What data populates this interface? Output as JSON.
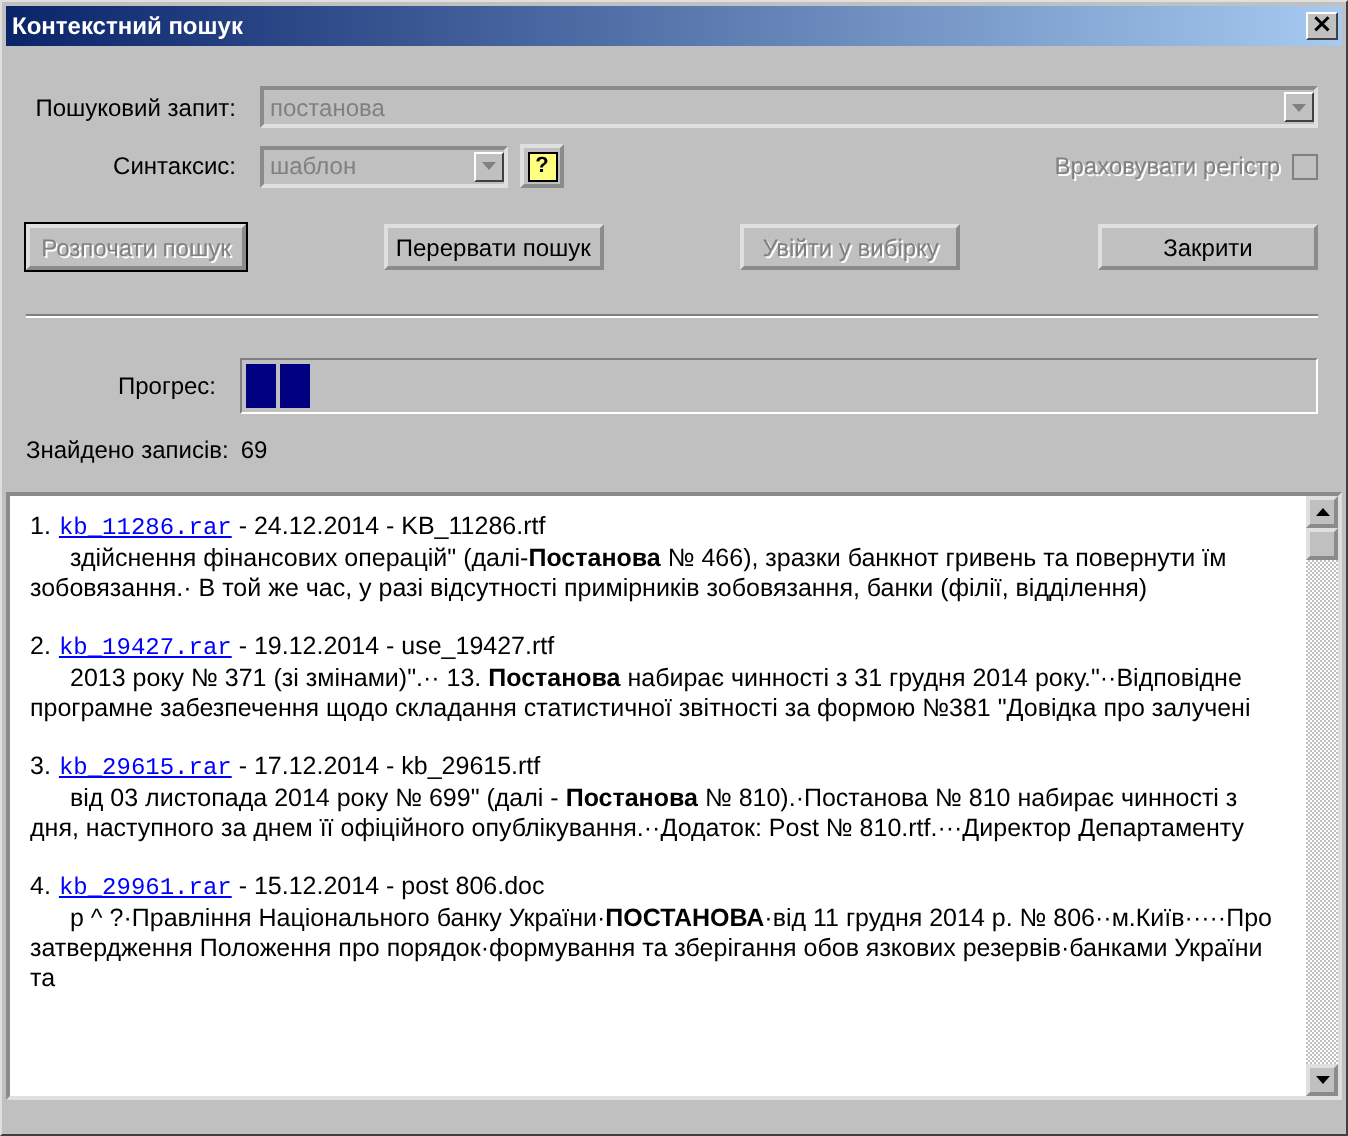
{
  "window": {
    "title": "Контекстний пошук",
    "close": "×"
  },
  "query": {
    "label": "Пошуковий запит:",
    "value": "постанова",
    "disabled": true
  },
  "syntax": {
    "label": "Синтаксис:",
    "value": "шаблон",
    "disabled": true,
    "help": "?"
  },
  "case_sensitive": {
    "label": "Враховувати регістр",
    "checked": false,
    "disabled": true
  },
  "buttons": [
    {
      "label": "Розпочати пошук",
      "disabled": true,
      "default": true
    },
    {
      "label": "Перервати пошук",
      "disabled": false,
      "default": false
    },
    {
      "label": "Увійти у вибірку",
      "disabled": true,
      "default": false
    },
    {
      "label": "Закрити",
      "disabled": false,
      "default": false
    }
  ],
  "progress": {
    "label": "Прогрес:",
    "level": 0.06
  },
  "found": {
    "label": "Знайдено записів:",
    "count": "69"
  },
  "results": [
    {
      "number": "1.",
      "link": "kb_11286.rar",
      "meta": " - 24.12.2014 - KB_11286.rtf",
      "snippet": "здійснення фінансових операцій\" (далі-**Постанова** № 466), зразки банкнот гривень та повернути їм зобовязання.· В той же час, у разі відсутності примірників зобовязання, банки (філії, відділення)"
    },
    {
      "number": "2.",
      "link": "kb_19427.rar",
      "meta": " - 19.12.2014 - use_19427.rtf",
      "snippet": "2013 року № 371 (зі змінами)\".·· 13. **Постанова** набирає чинності з 31 грудня 2014 року.\"··Відповідне програмне забезпечення щодо складання статистичної звітності за формою №381 \"Довідка про залучені"
    },
    {
      "number": "3.",
      "link": "kb_29615.rar",
      "meta": " - 17.12.2014 - kb_29615.rtf",
      "snippet": "від 03 листопада 2014 року № 699\" (далі - **Постанова** № 810).·Постанова № 810 набирає чинності з дня, наступного за днем її офіційного опублікування.··Додаток: Post № 810.rtf.···Директор Департаменту"
    },
    {
      "number": "4.",
      "link": "kb_29961.rar",
      "meta": " - 15.12.2014 - post 806.doc",
      "snippet": "р ^ ?·Правління Національного банку України·**ПОСТАНОВА**·від 11 грудня 2014 р. № 806··м.Київ·····Про затвердження Положення про порядок·формування та зберігання обов язкових резервів·банками України та"
    }
  ]
}
